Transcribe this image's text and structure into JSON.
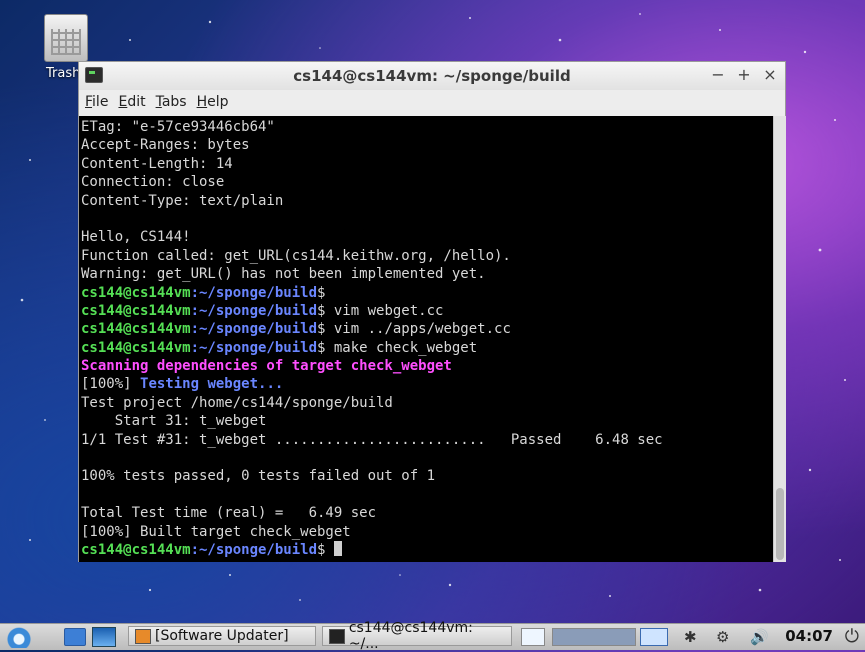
{
  "desktop": {
    "trash_label": "Trash"
  },
  "window": {
    "title": "cs144@cs144vm: ~/sponge/build",
    "controls": {
      "minimize": "−",
      "maximize": "+",
      "close": "×"
    },
    "menu": [
      "File",
      "Edit",
      "Tabs",
      "Help"
    ]
  },
  "terminal": {
    "prompt_user": "cs144@cs144vm",
    "prompt_path": ":~/sponge/build",
    "lines": [
      {
        "type": "plain",
        "text": "ETag: \"e-57ce93446cb64\""
      },
      {
        "type": "plain",
        "text": "Accept-Ranges: bytes"
      },
      {
        "type": "plain",
        "text": "Content-Length: 14"
      },
      {
        "type": "plain",
        "text": "Connection: close"
      },
      {
        "type": "plain",
        "text": "Content-Type: text/plain"
      },
      {
        "type": "plain",
        "text": ""
      },
      {
        "type": "plain",
        "text": "Hello, CS144!"
      },
      {
        "type": "plain",
        "text": "Function called: get_URL(cs144.keithw.org, /hello)."
      },
      {
        "type": "plain",
        "text": "Warning: get_URL() has not been implemented yet."
      },
      {
        "type": "prompt",
        "cmd": ""
      },
      {
        "type": "prompt",
        "cmd": " vim webget.cc"
      },
      {
        "type": "prompt",
        "cmd": " vim ../apps/webget.cc"
      },
      {
        "type": "prompt",
        "cmd": " make check_webget"
      },
      {
        "type": "magenta",
        "text": "Scanning dependencies of target check_webget"
      },
      {
        "type": "progress",
        "prefix": "[100%] ",
        "text": "Testing webget..."
      },
      {
        "type": "plain",
        "text": "Test project /home/cs144/sponge/build"
      },
      {
        "type": "plain",
        "text": "    Start 31: t_webget"
      },
      {
        "type": "plain",
        "text": "1/1 Test #31: t_webget .........................   Passed    6.48 sec"
      },
      {
        "type": "plain",
        "text": ""
      },
      {
        "type": "plain",
        "text": "100% tests passed, 0 tests failed out of 1"
      },
      {
        "type": "plain",
        "text": ""
      },
      {
        "type": "plain",
        "text": "Total Test time (real) =   6.49 sec"
      },
      {
        "type": "plain",
        "text": "[100%] Built target check_webget"
      },
      {
        "type": "prompt_cursor",
        "cmd": " "
      }
    ]
  },
  "taskbar": {
    "tasks": [
      {
        "label": "[Software Updater]"
      },
      {
        "label": "cs144@cs144vm: ~/..."
      }
    ],
    "clock": "04:07"
  }
}
